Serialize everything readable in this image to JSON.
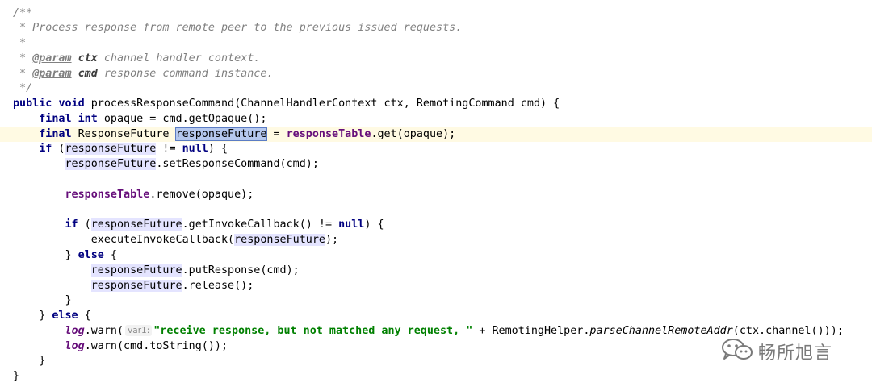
{
  "comment": {
    "open": "/**",
    "summary": " * Process response from remote peer to the previous issued requests.",
    "blank": " *",
    "star": " * ",
    "param_tag": "@param",
    "param1_name": "ctx",
    "param1_desc": " channel handler context.",
    "param2_name": "cmd",
    "param2_desc": " response command instance.",
    "close": " */"
  },
  "tokens": {
    "public": "public",
    "void": "void",
    "final": "final",
    "int": "int",
    "if": "if",
    "else": "else",
    "null": "null",
    "method_name": " processResponseCommand(ChannelHandlerContext ctx, RemotingCommand cmd) {",
    "opaque_assign": " opaque = cmd.getOpaque();",
    "rf_type": " ResponseFuture ",
    "response_future": "responseFuture",
    "eq": " = ",
    "response_table": "responseTable",
    "get_opaque": ".get(opaque);",
    "if_open": " (",
    "neq": " != ",
    "close_brace_open": ") {",
    "set_response_command": ".setResponseCommand(cmd);",
    "remove_opaque": ".remove(opaque);",
    "get_invoke_callback": ".getInvokeCallback() != ",
    "execute_invoke_callback": "executeInvokeCallback(",
    "close_semi": ");",
    "rbrace": "}",
    "else_open": " {",
    "put_response": ".putResponse(cmd);",
    "release": ".release();",
    "log": "log",
    "warn_open": ".warn(",
    "param_hint": "var1:",
    "warn_string": "\"receive response, but not matched any request, \"",
    "plus_helper": " + RemotingHelper.",
    "parse_remote_addr": "parseChannelRemoteAddr",
    "ctx_channel": "(ctx.channel()));",
    "warn_to_string": ".warn(cmd.toString());"
  },
  "watermark": {
    "icon": "wechat-icon",
    "text": "畅所旭言",
    "color": "#7a7a7a"
  },
  "colors": {
    "keyword": "#000080",
    "field": "#660e7a",
    "string": "#008000",
    "comment": "#808080",
    "caret_row": "#fffae3",
    "usage_highlight": "#e4e4ff",
    "selection": "#b5c8ee"
  }
}
